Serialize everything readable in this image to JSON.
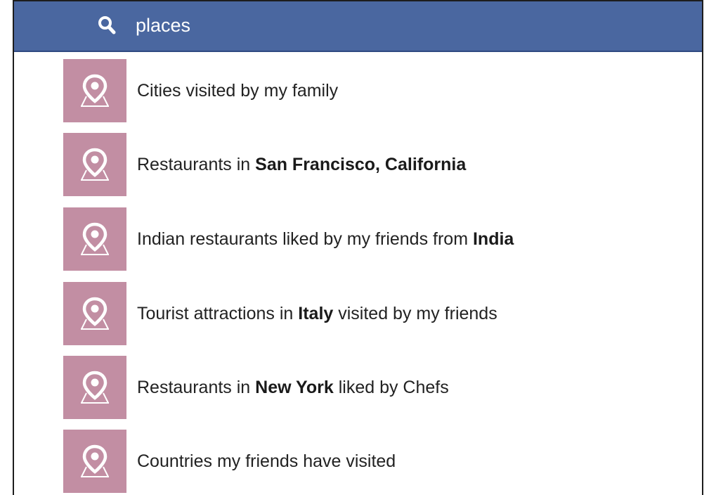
{
  "search": {
    "value": "places",
    "icon": "search-icon"
  },
  "colors": {
    "header": "#4a67a0",
    "thumb": "#c28ea3"
  },
  "results": [
    {
      "icon": "map-pin-icon",
      "parts": [
        {
          "t": "Cities visited by my family",
          "b": false
        }
      ]
    },
    {
      "icon": "map-pin-icon",
      "parts": [
        {
          "t": "Restaurants in ",
          "b": false
        },
        {
          "t": "San Francisco, California",
          "b": true
        }
      ]
    },
    {
      "icon": "map-pin-icon",
      "parts": [
        {
          "t": "Indian restaurants liked by my friends from ",
          "b": false
        },
        {
          "t": "India",
          "b": true
        }
      ]
    },
    {
      "icon": "map-pin-icon",
      "parts": [
        {
          "t": "Tourist attractions in ",
          "b": false
        },
        {
          "t": "Italy",
          "b": true
        },
        {
          "t": " visited by my friends",
          "b": false
        }
      ]
    },
    {
      "icon": "map-pin-icon",
      "parts": [
        {
          "t": "Restaurants in ",
          "b": false
        },
        {
          "t": "New York",
          "b": true
        },
        {
          "t": " liked by Chefs",
          "b": false
        }
      ]
    },
    {
      "icon": "map-pin-icon",
      "parts": [
        {
          "t": "Countries my friends have visited",
          "b": false
        }
      ]
    }
  ]
}
